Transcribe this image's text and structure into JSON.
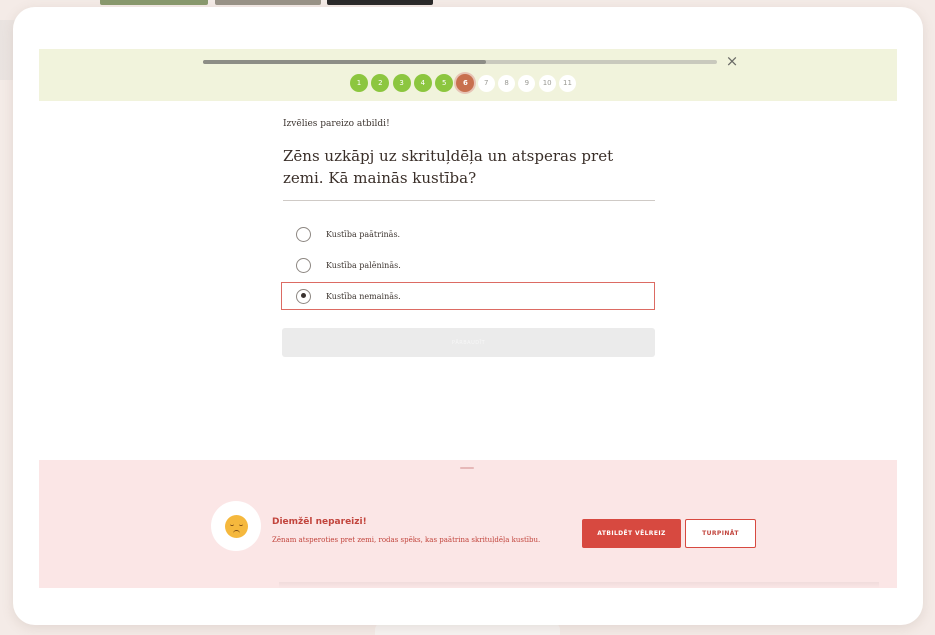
{
  "progress": {
    "fraction": 0.55,
    "steps": [
      {
        "label": "1",
        "state": "done"
      },
      {
        "label": "2",
        "state": "done"
      },
      {
        "label": "3",
        "state": "done"
      },
      {
        "label": "4",
        "state": "done"
      },
      {
        "label": "5",
        "state": "done"
      },
      {
        "label": "6",
        "state": "current"
      },
      {
        "label": "7",
        "state": "todo"
      },
      {
        "label": "8",
        "state": "todo"
      },
      {
        "label": "9",
        "state": "todo"
      },
      {
        "label": "10",
        "state": "todo"
      },
      {
        "label": "11",
        "state": "todo"
      }
    ]
  },
  "close_icon": "×",
  "quiz": {
    "instruction": "Izvēlies pareizo atbildi!",
    "question": "Zēns uzkāpj uz skrituļdēļa un atsperas pret zemi. Kā mainās kustība?",
    "options": [
      {
        "label": "Kustība paātrinās.",
        "selected": false
      },
      {
        "label": "Kustība palēninās.",
        "selected": false
      },
      {
        "label": "Kustība nemainās.",
        "selected": true
      }
    ],
    "check_label": "PĀRBAUDĪT"
  },
  "feedback": {
    "title": "Diemžēl nepareizi!",
    "text": "Zēnam atsperoties pret zemi, rodas spēks, kas paātrina skrituļdēļa kustību.",
    "retry_label": "ATBILDĒT VĒLREIZ",
    "continue_label": "TURPINĀT",
    "emoji_icon": "sad-face-icon"
  },
  "colors": {
    "header_bg": "#f1f3dc",
    "step_done": "#8cc63f",
    "step_current": "#c8704f",
    "feedback_bg": "#fbe6e6",
    "accent_red": "#d74940"
  }
}
